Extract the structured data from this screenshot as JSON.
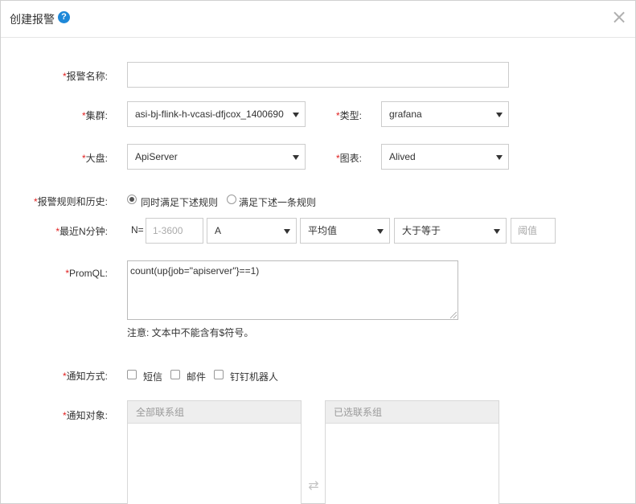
{
  "dialog": {
    "title": "创建报警",
    "help_glyph": "?",
    "close_glyph": "×"
  },
  "form": {
    "req_mark": "*",
    "alert_name": {
      "label": "报警名称:",
      "value": ""
    },
    "cluster": {
      "label": "集群:",
      "value": "asi-bj-flink-h-vcasi-dfjcox_1400690"
    },
    "type": {
      "label": "类型:",
      "value": "grafana"
    },
    "dashboard": {
      "label": "大盘:",
      "value": "ApiServer"
    },
    "chart": {
      "label": "图表:",
      "value": "Alived"
    },
    "rules_history": {
      "label": "报警规则和历史:",
      "options": [
        "同时满足下述规则",
        "满足下述一条规则"
      ],
      "selected": 0
    },
    "recent_n": {
      "label": "最近N分钟:",
      "n_prefix": "N=",
      "n_placeholder": "1-3600",
      "series": "A",
      "aggregation": "平均值",
      "operator": "大于等于",
      "threshold_placeholder": "阈值"
    },
    "promql": {
      "label": "PromQL:",
      "value": "count(up{job=\"apiserver\"}==1)",
      "note": "注意: 文本中不能含有$符号。"
    },
    "notify_method": {
      "label": "通知方式:",
      "options": [
        "短信",
        "邮件",
        "钉钉机器人"
      ]
    },
    "notify_target": {
      "label": "通知对象:",
      "all_groups": "全部联系组",
      "selected_groups": "已选联系组",
      "transfer_glyph": "⇄"
    }
  }
}
